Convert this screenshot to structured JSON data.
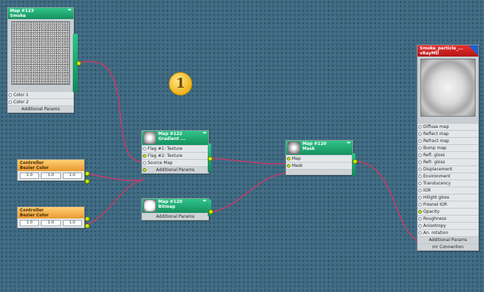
{
  "badge": {
    "label": "1"
  },
  "smoke_node": {
    "title": "Map #123",
    "subtitle": "Smoke",
    "rows": [
      "Color 1",
      "Color 2"
    ],
    "footer": "Additional Params"
  },
  "controller1": {
    "title": "Controller",
    "subtitle": "Bezier Color",
    "values": [
      "1.0",
      "1.0",
      "1.0"
    ]
  },
  "controller2": {
    "title": "Controller",
    "subtitle": "Bezier Color",
    "values": [
      "1.0",
      "1.0",
      "1.0"
    ]
  },
  "gradient_node": {
    "title": "Map #122",
    "subtitle": "Gradient ...",
    "rows": [
      "Flag #1: Texture",
      "Flag #2: Texture",
      "Source Map"
    ],
    "footer": "Additional Params"
  },
  "bitmap_node": {
    "title": "Map #120",
    "subtitle": "Bitmap",
    "footer": "Additional Params"
  },
  "mask_node": {
    "title": "Map #120",
    "subtitle": "Mask",
    "rows": [
      "Map",
      "Mask"
    ]
  },
  "material_node": {
    "title": "Smoke_particle_...",
    "subtitle": "vRayMtl",
    "rows": [
      "Diffuse map",
      "Reflect map",
      "Refract map",
      "Bump map",
      "Refl. gloss",
      "Refr. gloss",
      "Displacement",
      "Environment",
      "Translucency",
      "IOR",
      "Hilight gloss",
      "Fresnel IOR",
      "Opacity",
      "Roughness",
      "Anisotropy",
      "An. rotation"
    ],
    "footer1": "Additional Params",
    "footer2": "mr Connection"
  },
  "colors": {
    "background": "#3f6a82",
    "node_header_green": "#1fa870",
    "node_header_orange": "#f2b04c",
    "node_header_red": "#c91c1c",
    "socket_active": "#c8f000",
    "wire": "#c83a68"
  }
}
